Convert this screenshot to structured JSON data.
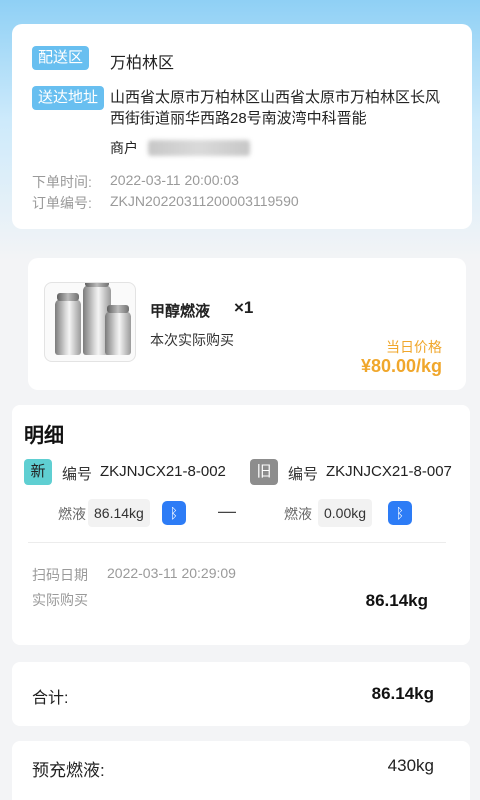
{
  "address": {
    "zone_tag": "配送区",
    "zone_value": "万柏林区",
    "delivery_tag": "送达地址",
    "delivery_line1": "山西省太原市万柏林区山西省太原市万柏林区长风",
    "delivery_line2": "西街街道丽华西路28号南波湾中科晋能",
    "merchant_label": "商户",
    "order_time_label": "下单时间:",
    "order_time": "2022-03-11 20:00:03",
    "order_no_label": "订单编号:",
    "order_no": "ZKJN20220311200003119590"
  },
  "product": {
    "name": "甲醇燃液",
    "quantity": "×1",
    "subtitle": "本次实际购买",
    "price_label": "当日价格",
    "price": "¥80.00/kg"
  },
  "detail": {
    "title": "明细",
    "new_badge": "新",
    "new_id_label": "编号",
    "new_id": "ZKJNJCX21-8-002",
    "old_badge": "旧",
    "old_id_label": "编号",
    "old_id": "ZKJNJCX21-8-007",
    "fuel_label": "燃液",
    "new_fuel": "86.14kg",
    "old_fuel": "0.00kg",
    "dash": "—",
    "bluetooth_icon": "ᛒ",
    "scan_date_label": "扫码日期",
    "scan_date": "2022-03-11 20:29:09",
    "actual_label": "实际购买",
    "actual_value": "86.14kg"
  },
  "total": {
    "label": "合计:",
    "value": "86.14kg"
  },
  "prefill": {
    "label": "预充燃液:",
    "value": "430kg"
  },
  "colors": {
    "tag_blue": "#68bff0",
    "price_orange": "#f0a72c",
    "new_badge_bg": "#5fcfd2",
    "old_badge_bg": "#8d8d8d",
    "bluetooth_blue": "#2d7cf6"
  }
}
